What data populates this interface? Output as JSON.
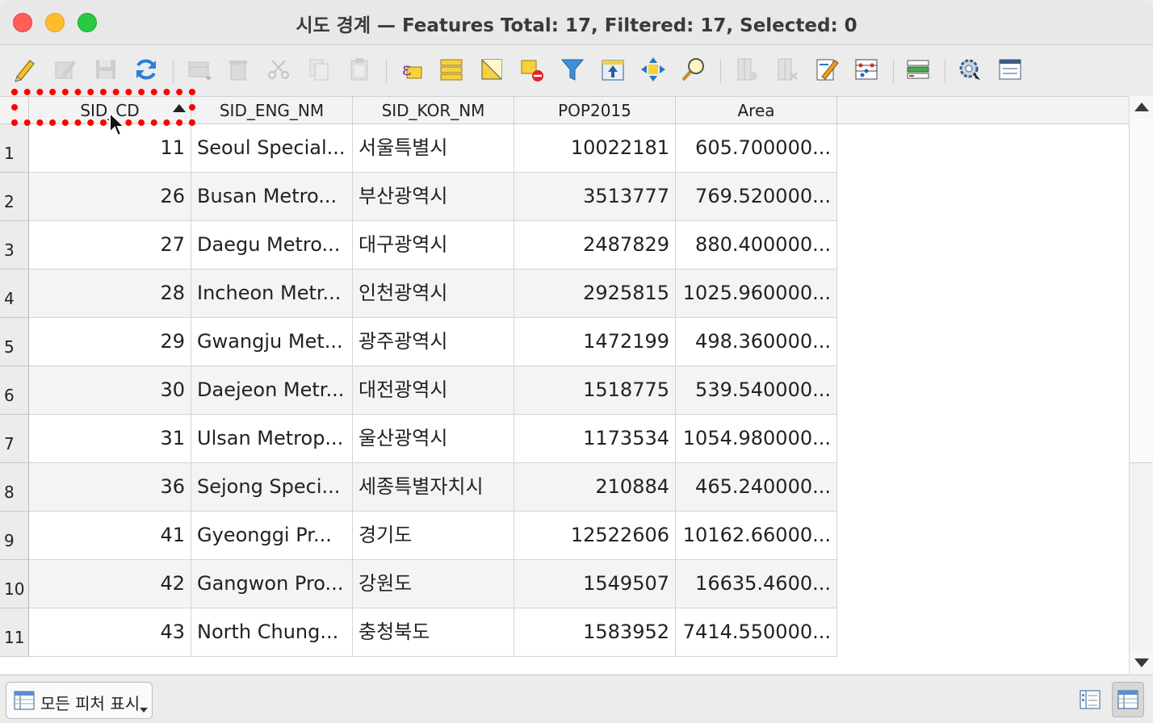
{
  "window": {
    "title": "시도 경계 — Features Total: 17, Filtered: 17, Selected: 0"
  },
  "toolbar": {
    "buttons": [
      {
        "name": "toggle-editing",
        "icon": "pencil-icon",
        "enabled": true
      },
      {
        "name": "multi-edit",
        "icon": "multi-edit-icon",
        "enabled": false
      },
      {
        "name": "save-edits",
        "icon": "save-icon",
        "enabled": false
      },
      {
        "name": "reload",
        "icon": "refresh-icon",
        "enabled": true
      },
      {
        "name": "add-feature",
        "icon": "add-row-icon",
        "enabled": false
      },
      {
        "name": "delete-selected",
        "icon": "trash-icon",
        "enabled": false
      },
      {
        "name": "cut",
        "icon": "scissors-icon",
        "enabled": false
      },
      {
        "name": "copy",
        "icon": "copy-icon",
        "enabled": false
      },
      {
        "name": "paste",
        "icon": "paste-icon",
        "enabled": false
      },
      {
        "name": "select-by-expression",
        "icon": "expression-icon",
        "enabled": true
      },
      {
        "name": "select-all",
        "icon": "select-all-icon",
        "enabled": true
      },
      {
        "name": "invert-selection",
        "icon": "invert-selection-icon",
        "enabled": true
      },
      {
        "name": "deselect-all",
        "icon": "deselect-icon",
        "enabled": true
      },
      {
        "name": "filter",
        "icon": "filter-icon",
        "enabled": true
      },
      {
        "name": "move-selection-top",
        "icon": "move-top-icon",
        "enabled": true
      },
      {
        "name": "pan-to-selected",
        "icon": "pan-icon",
        "enabled": true
      },
      {
        "name": "zoom-to-selected",
        "icon": "zoom-icon",
        "enabled": true
      },
      {
        "name": "new-field",
        "icon": "new-field-icon",
        "enabled": false
      },
      {
        "name": "delete-field",
        "icon": "delete-field-icon",
        "enabled": false
      },
      {
        "name": "field-calculator",
        "icon": "field-calc-icon",
        "enabled": true
      },
      {
        "name": "conditional-formatting",
        "icon": "abacus-icon",
        "enabled": true
      },
      {
        "name": "actions",
        "icon": "actions-icon",
        "enabled": true
      },
      {
        "name": "dock",
        "icon": "gear-icon",
        "enabled": true
      },
      {
        "name": "form-view",
        "icon": "window-icon",
        "enabled": true
      }
    ]
  },
  "table": {
    "columns": [
      "SID_CD",
      "SID_ENG_NM",
      "SID_KOR_NM",
      "POP2015",
      "Area"
    ],
    "sorted_column": "SID_CD",
    "sort_direction": "ascending",
    "rows": [
      {
        "n": "1",
        "SID_CD": "11",
        "SID_ENG_NM": "Seoul Special...",
        "SID_KOR_NM": "서울특별시",
        "POP2015": "10022181",
        "Area": "605.700000..."
      },
      {
        "n": "2",
        "SID_CD": "26",
        "SID_ENG_NM": "Busan Metro...",
        "SID_KOR_NM": "부산광역시",
        "POP2015": "3513777",
        "Area": "769.520000..."
      },
      {
        "n": "3",
        "SID_CD": "27",
        "SID_ENG_NM": "Daegu Metro...",
        "SID_KOR_NM": "대구광역시",
        "POP2015": "2487829",
        "Area": "880.400000..."
      },
      {
        "n": "4",
        "SID_CD": "28",
        "SID_ENG_NM": "Incheon Metr...",
        "SID_KOR_NM": "인천광역시",
        "POP2015": "2925815",
        "Area": "1025.960000..."
      },
      {
        "n": "5",
        "SID_CD": "29",
        "SID_ENG_NM": "Gwangju Met...",
        "SID_KOR_NM": "광주광역시",
        "POP2015": "1472199",
        "Area": "498.360000..."
      },
      {
        "n": "6",
        "SID_CD": "30",
        "SID_ENG_NM": "Daejeon Metr...",
        "SID_KOR_NM": "대전광역시",
        "POP2015": "1518775",
        "Area": "539.540000..."
      },
      {
        "n": "7",
        "SID_CD": "31",
        "SID_ENG_NM": "Ulsan Metrop...",
        "SID_KOR_NM": "울산광역시",
        "POP2015": "1173534",
        "Area": "1054.980000..."
      },
      {
        "n": "8",
        "SID_CD": "36",
        "SID_ENG_NM": "Sejong Speci...",
        "SID_KOR_NM": "세종특별자치시",
        "POP2015": "210884",
        "Area": "465.240000..."
      },
      {
        "n": "9",
        "SID_CD": "41",
        "SID_ENG_NM": "Gyeonggi Pr...",
        "SID_KOR_NM": "경기도",
        "POP2015": "12522606",
        "Area": "10162.66000..."
      },
      {
        "n": "10",
        "SID_CD": "42",
        "SID_ENG_NM": "Gangwon Pro...",
        "SID_KOR_NM": "강원도",
        "POP2015": "1549507",
        "Area": "16635.4600..."
      },
      {
        "n": "11",
        "SID_CD": "43",
        "SID_ENG_NM": "North Chung...",
        "SID_KOR_NM": "충청북도",
        "POP2015": "1583952",
        "Area": "7414.550000..."
      }
    ]
  },
  "bottom": {
    "filter_button_label": "모든 피처 표시",
    "filter_icon": "table-icon",
    "view_buttons": [
      {
        "name": "form-view",
        "icon": "form-view-icon",
        "active": false
      },
      {
        "name": "table-view",
        "icon": "table-view-icon",
        "active": true
      }
    ]
  },
  "colors": {
    "annotation": "#ff0000",
    "row_alt": "#f4f4f4",
    "header_bg": "#f3f3f3"
  }
}
